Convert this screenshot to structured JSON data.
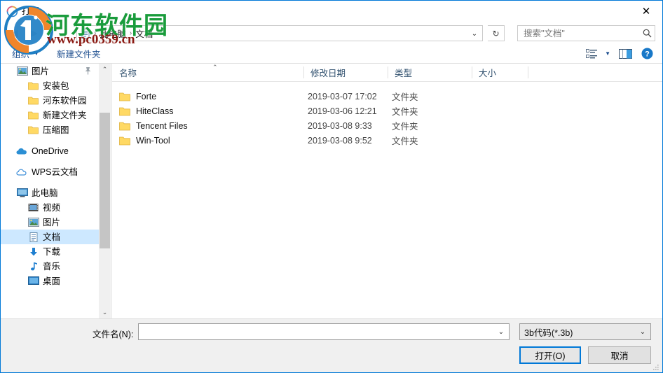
{
  "window": {
    "title": "打开",
    "title_icon": "open-file-icon",
    "close_label": "✕"
  },
  "nav": {
    "back_icon": "◀",
    "forward_icon": "▶",
    "history_icon": "⌄",
    "up_icon": "↑",
    "refresh_icon": "↻",
    "breadcrumb": [
      {
        "label": "此电脑"
      },
      {
        "label": "文档"
      }
    ],
    "breadcrumb_separator": "›",
    "breadcrumb_dropdown_icon": "⌄"
  },
  "search": {
    "placeholder": "搜索\"文档\"",
    "value": "",
    "icon": "search-icon"
  },
  "toolbar": {
    "organize_label": "组织",
    "organize_caret": "▼",
    "new_folder_label": "新建文件夹",
    "view_caret": "▼",
    "help_label": "?"
  },
  "sidebar": {
    "items": [
      {
        "label": "图片",
        "icon": "picture-icon",
        "level": "top",
        "pinned": true,
        "selected": false
      },
      {
        "label": "安装包",
        "icon": "folder-icon",
        "level": "child",
        "pinned": false,
        "selected": false
      },
      {
        "label": "河东软件园",
        "icon": "folder-icon",
        "level": "child",
        "pinned": false,
        "selected": false
      },
      {
        "label": "新建文件夹",
        "icon": "folder-icon",
        "level": "child",
        "pinned": false,
        "selected": false
      },
      {
        "label": "压缩图",
        "icon": "folder-icon",
        "level": "child",
        "pinned": false,
        "selected": false
      },
      {
        "label": "OneDrive",
        "icon": "onedrive-cloud-icon",
        "level": "top",
        "pinned": false,
        "selected": false
      },
      {
        "label": "WPS云文档",
        "icon": "wps-cloud-icon",
        "level": "top",
        "pinned": false,
        "selected": false
      },
      {
        "label": "此电脑",
        "icon": "this-pc-icon",
        "level": "top",
        "pinned": false,
        "selected": false
      },
      {
        "label": "视频",
        "icon": "video-icon",
        "level": "child",
        "pinned": false,
        "selected": false
      },
      {
        "label": "图片",
        "icon": "picture-icon",
        "level": "child",
        "pinned": false,
        "selected": false
      },
      {
        "label": "文档",
        "icon": "documents-icon",
        "level": "child",
        "pinned": false,
        "selected": true
      },
      {
        "label": "下载",
        "icon": "download-icon",
        "level": "child",
        "pinned": false,
        "selected": false
      },
      {
        "label": "音乐",
        "icon": "music-icon",
        "level": "child",
        "pinned": false,
        "selected": false
      },
      {
        "label": "桌面",
        "icon": "desktop-icon",
        "level": "child",
        "pinned": false,
        "selected": false
      }
    ],
    "scroll_up_icon": "⌃",
    "scroll_down_icon": "⌄"
  },
  "filelist": {
    "columns": [
      {
        "label": "名称",
        "key": "name"
      },
      {
        "label": "修改日期",
        "key": "date"
      },
      {
        "label": "类型",
        "key": "type"
      },
      {
        "label": "大小",
        "key": "size"
      }
    ],
    "sort_indicator": "⌃",
    "rows": [
      {
        "name": "Forte",
        "date": "2019-03-07 17:02",
        "type": "文件夹",
        "size": "",
        "icon": "folder-icon"
      },
      {
        "name": "HiteClass",
        "date": "2019-03-06 12:21",
        "type": "文件夹",
        "size": "",
        "icon": "folder-icon"
      },
      {
        "name": "Tencent Files",
        "date": "2019-03-08 9:33",
        "type": "文件夹",
        "size": "",
        "icon": "folder-icon"
      },
      {
        "name": "Win-Tool",
        "date": "2019-03-08 9:52",
        "type": "文件夹",
        "size": "",
        "icon": "folder-icon"
      }
    ]
  },
  "bottom": {
    "filename_label": "文件名(N):",
    "filename_value": "",
    "filename_placeholder": "",
    "filename_arrow": "⌄",
    "filter_value": "3b代码(*.3b)",
    "filter_arrow": "⌄",
    "open_label": "打开(O)",
    "cancel_label": "取消"
  },
  "watermark": {
    "text": "河东软件园",
    "url": "www.pc0359.cn",
    "text_color": "#1a9c3c",
    "url_color": "#8b1a13"
  },
  "colors": {
    "accent": "#0078d7",
    "selection": "#cde8ff",
    "toolbar_text": "#1d4e8f",
    "folder": "#ffd25e"
  }
}
